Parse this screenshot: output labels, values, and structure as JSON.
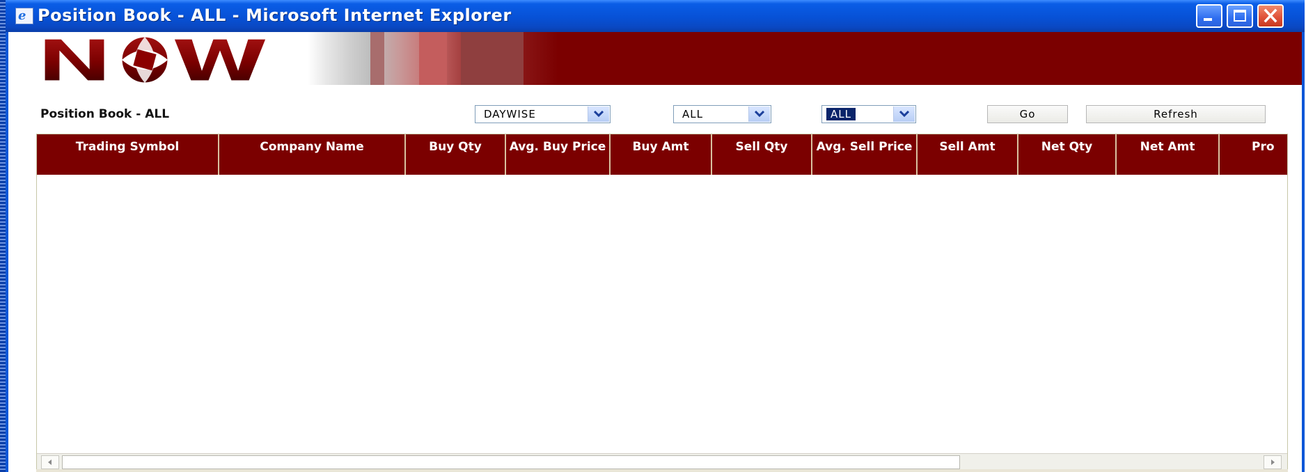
{
  "window": {
    "title": "Position Book - ALL - Microsoft Internet Explorer",
    "icon": "ie-page-icon",
    "controls": [
      "minimize-icon",
      "maximize-icon",
      "close-icon"
    ]
  },
  "banner": {
    "logo_text": "NOW",
    "colors": {
      "banner": "#7b0000"
    }
  },
  "toolbar": {
    "heading": "Position Book - ALL",
    "selects": [
      {
        "value": "DAYWISE"
      },
      {
        "value": "ALL"
      },
      {
        "value": "ALL"
      }
    ],
    "go_label": "Go",
    "refresh_label": "Refresh"
  },
  "table": {
    "columns": [
      "Trading Symbol",
      "Company Name",
      "Buy Qty",
      "Avg. Buy Price",
      "Buy Amt",
      "Sell Qty",
      "Avg. Sell Price",
      "Sell Amt",
      "Net Qty",
      "Net Amt",
      "Pro"
    ],
    "rows": [],
    "header_color": "#7b0000"
  }
}
